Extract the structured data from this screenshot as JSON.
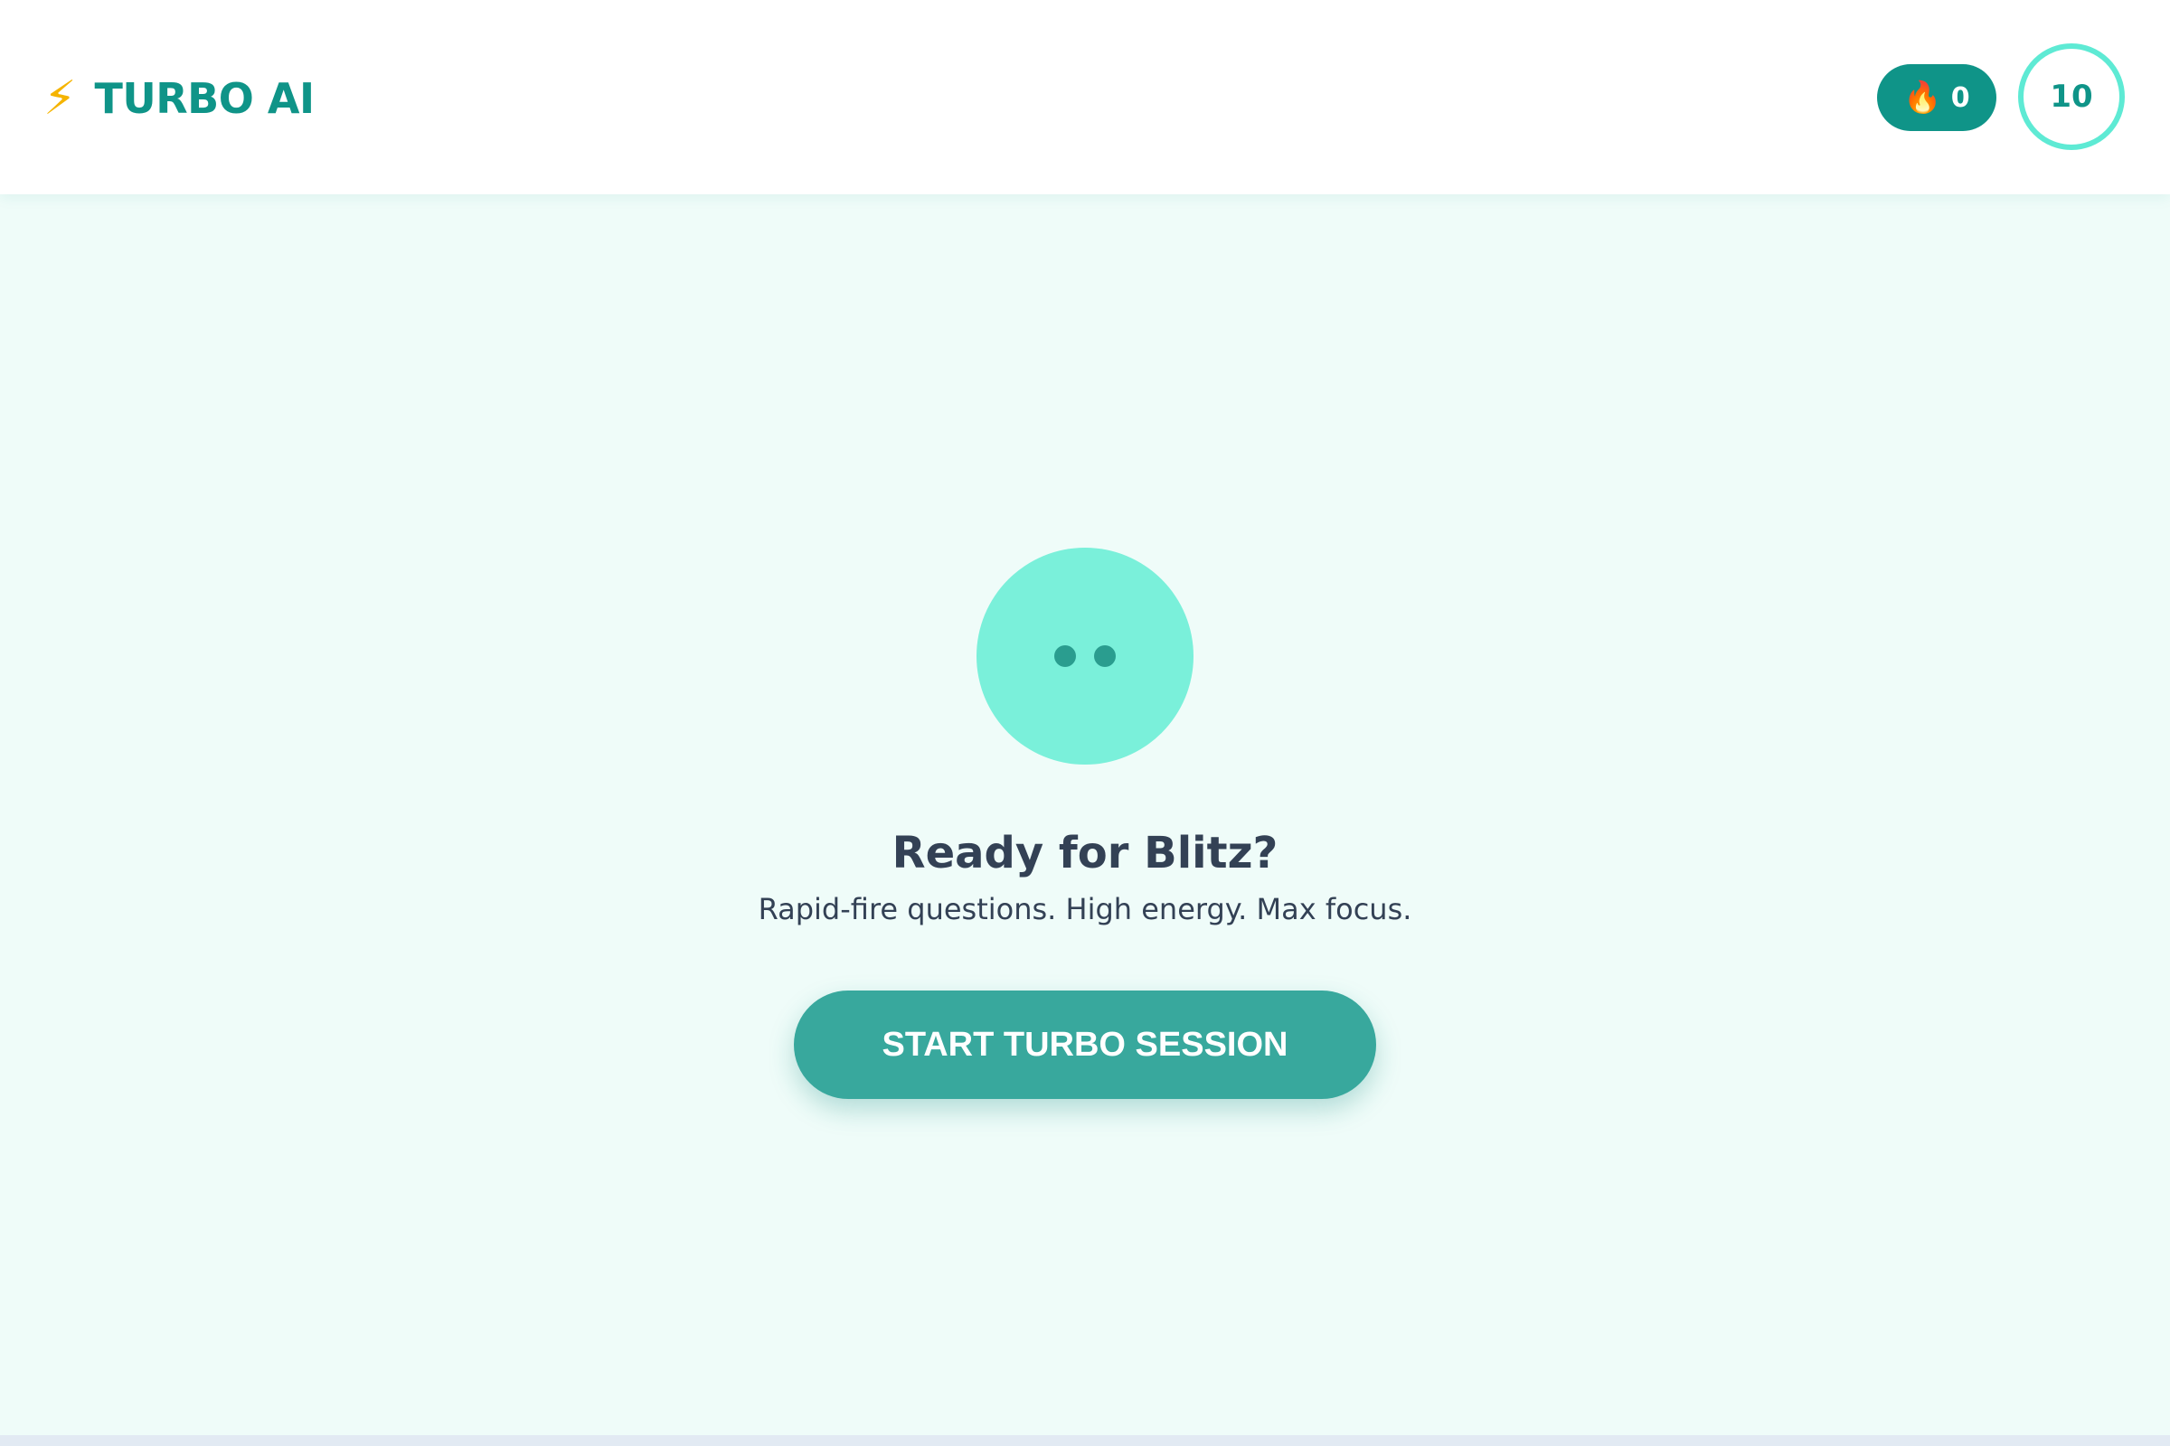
{
  "header": {
    "brand_icon": "lightning-bolt-icon",
    "brand_title": "TURBO AI",
    "streak": {
      "icon": "flame-icon",
      "count": "0"
    },
    "timer": {
      "value": "10"
    }
  },
  "main": {
    "avatar_icon": "robot-face-icon",
    "heading": "Ready for Blitz?",
    "subtext": "Rapid-fire questions. High energy. Max focus.",
    "start_button_label": "START TURBO SESSION"
  },
  "colors": {
    "accent": "#0f9488",
    "accent_light": "#5eead4",
    "avatar": "#7af0da",
    "background": "#effcf9",
    "button": "#38a89d",
    "text": "#334155"
  }
}
